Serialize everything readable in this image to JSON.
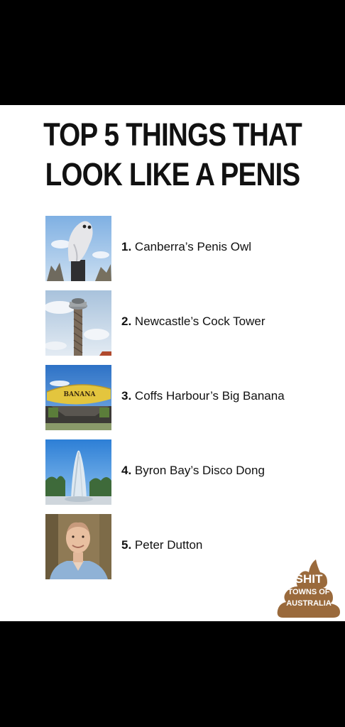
{
  "title": {
    "line1": "TOP 5 THINGS THAT",
    "line2": "LOOK LIKE A PENIS"
  },
  "items": [
    {
      "number": "1.",
      "text": "Canberra’s Penis Owl"
    },
    {
      "number": "2.",
      "text": "Newcastle’s Cock Tower"
    },
    {
      "number": "3.",
      "text": "Coffs Harbour’s Big Banana",
      "sign_text": "BANANA"
    },
    {
      "number": "4.",
      "text": "Byron Bay’s Disco Dong"
    },
    {
      "number": "5.",
      "text": "Peter Dutton"
    }
  ],
  "logo": {
    "line1": "SHIT",
    "line2": "TOWNS OF",
    "line3": "AUSTRALIA",
    "color": "#9a6a3c"
  },
  "colors": {
    "background": "#000000",
    "panel": "#ffffff",
    "text": "#111111"
  }
}
